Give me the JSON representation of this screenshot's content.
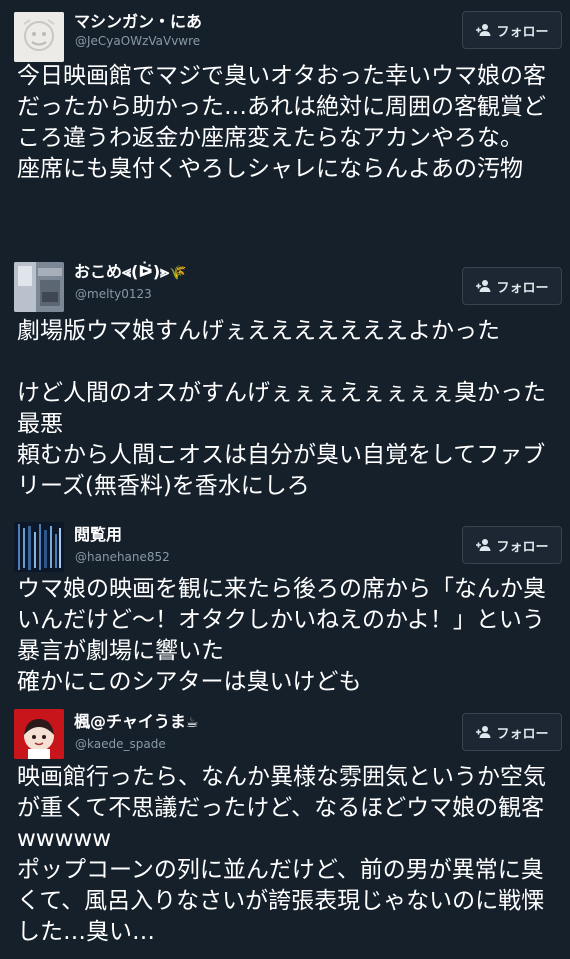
{
  "follow_label": "フォロー",
  "tweets": [
    {
      "display_name": "マシンガン・にあ",
      "handle": "@JeCyaOWzVaVvwre",
      "text": "今日映画館でマジで臭いオタおった幸いウマ娘の客だったから助かった…あれは絶対に周囲の客観賞どころ違うわ返金か座席変えたらなアカンやろな。\n座席にも臭付くやろしシャレにならんよあの汚物"
    },
    {
      "display_name": "おこめ⪡(ᐖ)⪢",
      "name_emoji": "🌾",
      "handle": "@melty0123",
      "text": "劇場版ウマ娘すんげぇえええええええよかった\n\nけど人間のオスがすんげぇぇぇえぇぇぇぇ臭かった 最悪\n頼むから人間こオスは自分が臭い自覚をしてファブリーズ(無香料)を香水にしろ"
    },
    {
      "display_name": "閲覧用",
      "handle": "@hanehane852",
      "text": "ウマ娘の映画を観に来たら後ろの席から「なんか臭いんだけど〜！オタクしかいねえのかよ！」という暴言が劇場に響いた\n確かにこのシアターは臭いけども"
    },
    {
      "display_name": "楓@チャイうま",
      "name_emoji": "☕",
      "handle": "@kaede_spade",
      "text": "映画館行ったら、なんか異様な雰囲気というか空気が重くて不思議だったけど、なるほどウマ娘の観客wwwww\nポップコーンの列に並んだけど、前の男が異常に臭くて、風呂入りなさいが誇張表現じゃないのに戦慄した…臭い…"
    }
  ],
  "colors": {
    "background": "#15202b",
    "handle": "#8899a6",
    "button_bg": "#1c2733",
    "button_border": "#38444d"
  }
}
